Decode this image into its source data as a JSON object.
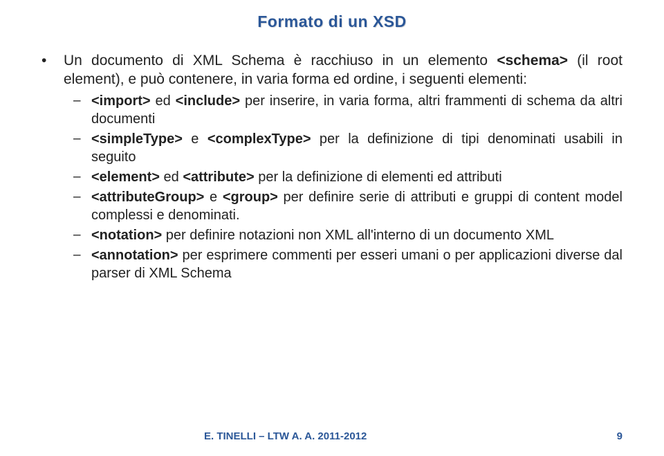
{
  "title": "Formato di un XSD",
  "main_bullet": {
    "prefix": "Un documento di XML Schema è racchiuso in un elemento ",
    "tag": "<schema>",
    "suffix": " (il root element), e può contenere, in varia forma ed ordine, i seguenti elementi:"
  },
  "sub_bullets": [
    {
      "segments": [
        {
          "bold": true,
          "text": "<import>"
        },
        {
          "bold": false,
          "text": " ed "
        },
        {
          "bold": true,
          "text": "<include>"
        },
        {
          "bold": false,
          "text": " per inserire, in varia forma, altri frammenti di schema da altri documenti"
        }
      ]
    },
    {
      "segments": [
        {
          "bold": true,
          "text": "<simpleType>"
        },
        {
          "bold": false,
          "text": " e "
        },
        {
          "bold": true,
          "text": "<complexType>"
        },
        {
          "bold": false,
          "text": " per la definizione di tipi denominati usabili in seguito"
        }
      ]
    },
    {
      "segments": [
        {
          "bold": true,
          "text": "<element>"
        },
        {
          "bold": false,
          "text": " ed "
        },
        {
          "bold": true,
          "text": "<attribute>"
        },
        {
          "bold": false,
          "text": " per la definizione di elementi ed attributi"
        }
      ]
    },
    {
      "segments": [
        {
          "bold": true,
          "text": "<attributeGroup>"
        },
        {
          "bold": false,
          "text": " e "
        },
        {
          "bold": true,
          "text": "<group>"
        },
        {
          "bold": false,
          "text": " per definire serie di attributi e gruppi di content model complessi e denominati."
        }
      ]
    },
    {
      "segments": [
        {
          "bold": true,
          "text": "<notation>"
        },
        {
          "bold": false,
          "text": " per definire notazioni non XML all'interno di un documento XML"
        }
      ]
    },
    {
      "segments": [
        {
          "bold": true,
          "text": "<annotation>"
        },
        {
          "bold": false,
          "text": " per esprimere commenti per esseri umani o per applicazioni diverse dal parser di XML Schema"
        }
      ]
    }
  ],
  "footer": {
    "left": "E. TINELLI – LTW  A. A. 2011-2012",
    "right": "9"
  }
}
